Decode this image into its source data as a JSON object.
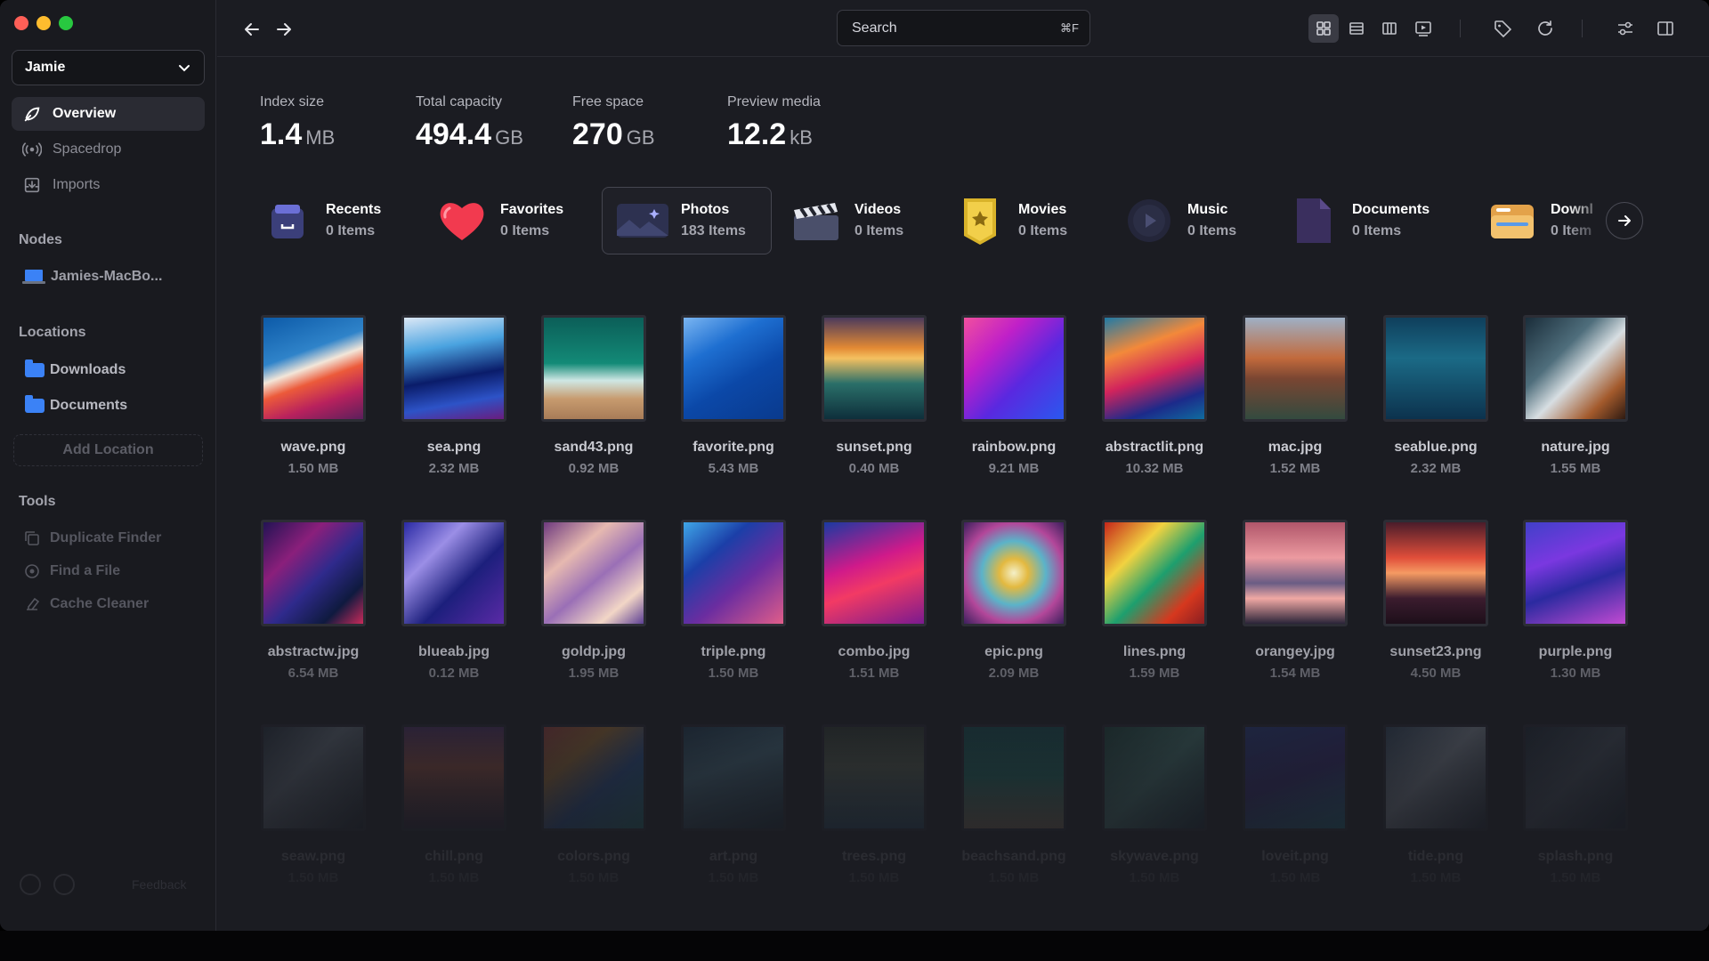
{
  "sidebar": {
    "account": "Jamie",
    "nav": [
      {
        "label": "Overview",
        "icon": "overview-icon"
      },
      {
        "label": "Spacedrop",
        "icon": "spacedrop-icon"
      },
      {
        "label": "Imports",
        "icon": "imports-icon"
      }
    ],
    "nodes_heading": "Nodes",
    "node": "Jamies-MacBo...",
    "locations_heading": "Locations",
    "locations": [
      "Downloads",
      "Documents"
    ],
    "add_location": "Add Location",
    "tools_heading": "Tools",
    "tools": [
      "Duplicate Finder",
      "Find a File",
      "Cache Cleaner"
    ],
    "footer_feedback": "Feedback"
  },
  "topbar": {
    "search_placeholder": "Search",
    "search_shortcut": "⌘F"
  },
  "stats": [
    {
      "label": "Index size",
      "value": "1.4",
      "unit": "MB"
    },
    {
      "label": "Total capacity",
      "value": "494.4",
      "unit": "GB"
    },
    {
      "label": "Free space",
      "value": "270",
      "unit": "GB"
    },
    {
      "label": "Preview media",
      "value": "12.2",
      "unit": "kB"
    }
  ],
  "categories": [
    {
      "name": "Recents",
      "count": "0 Items"
    },
    {
      "name": "Favorites",
      "count": "0 Items"
    },
    {
      "name": "Photos",
      "count": "183 Items"
    },
    {
      "name": "Videos",
      "count": "0 Items"
    },
    {
      "name": "Movies",
      "count": "0 Items"
    },
    {
      "name": "Music",
      "count": "0 Items"
    },
    {
      "name": "Documents",
      "count": "0 Items"
    },
    {
      "name": "Downl",
      "count": "0 Item"
    }
  ],
  "files": [
    {
      "name": "wave.png",
      "size": "1.50 MB"
    },
    {
      "name": "sea.png",
      "size": "2.32 MB"
    },
    {
      "name": "sand43.png",
      "size": "0.92 MB"
    },
    {
      "name": "favorite.png",
      "size": "5.43 MB"
    },
    {
      "name": "sunset.png",
      "size": "0.40 MB"
    },
    {
      "name": "rainbow.png",
      "size": "9.21 MB"
    },
    {
      "name": "abstractlit.png",
      "size": "10.32 MB"
    },
    {
      "name": "mac.jpg",
      "size": "1.52 MB"
    },
    {
      "name": "seablue.png",
      "size": "2.32 MB"
    },
    {
      "name": "nature.jpg",
      "size": "1.55 MB"
    },
    {
      "name": "abstractw.jpg",
      "size": "6.54 MB"
    },
    {
      "name": "blueab.jpg",
      "size": "0.12 MB"
    },
    {
      "name": "goldp.jpg",
      "size": "1.95 MB"
    },
    {
      "name": "triple.png",
      "size": "1.50 MB"
    },
    {
      "name": "combo.jpg",
      "size": "1.51 MB"
    },
    {
      "name": "epic.png",
      "size": "2.09 MB"
    },
    {
      "name": "lines.png",
      "size": "1.59 MB"
    },
    {
      "name": "orangey.jpg",
      "size": "1.54 MB"
    },
    {
      "name": "sunset23.png",
      "size": "4.50 MB"
    },
    {
      "name": "purple.png",
      "size": "1.30 MB"
    },
    {
      "name": "seaw.png",
      "size": "1.50 MB"
    },
    {
      "name": "chill.png",
      "size": "1.50 MB"
    },
    {
      "name": "colors.png",
      "size": "1.50 MB"
    },
    {
      "name": "art.png",
      "size": "1.50 MB"
    },
    {
      "name": "trees.png",
      "size": "1.50 MB"
    },
    {
      "name": "beachsand.png",
      "size": "1.50 MB"
    },
    {
      "name": "skywave.png",
      "size": "1.50 MB"
    },
    {
      "name": "loveit.png",
      "size": "1.50 MB"
    },
    {
      "name": "tide.png",
      "size": "1.50 MB"
    },
    {
      "name": "splash.png",
      "size": "1.50 MB"
    }
  ]
}
